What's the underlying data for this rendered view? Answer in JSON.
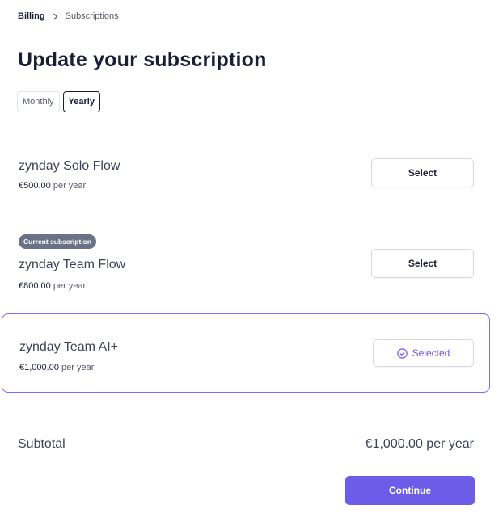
{
  "breadcrumb": {
    "parent": "Billing",
    "current": "Subscriptions"
  },
  "page_title": "Update your subscription",
  "interval_toggle": {
    "options": [
      "Monthly",
      "Yearly"
    ],
    "selected": "Yearly"
  },
  "plans": [
    {
      "name": "zynday Solo Flow",
      "price": "€500.00",
      "unit": "per year",
      "badge": "",
      "button_label": "Select",
      "selected": false
    },
    {
      "name": "zynday Team Flow",
      "price": "€800.00",
      "unit": "per year",
      "badge": "Current subscription",
      "button_label": "Select",
      "selected": false
    },
    {
      "name": "zynday Team AI+",
      "price": "€1,000.00",
      "unit": "per year",
      "badge": "",
      "button_label": "Selected",
      "selected": true,
      "button_icon": "check-circle-icon"
    }
  ],
  "subtotal": {
    "label": "Subtotal",
    "value": "€1,000.00 per year"
  },
  "continue_label": "Continue",
  "colors": {
    "accent": "#6c5ce7",
    "selected_border": "#7c6cf0",
    "badge_bg": "#6b7285",
    "text_dark": "#1a1f36"
  }
}
